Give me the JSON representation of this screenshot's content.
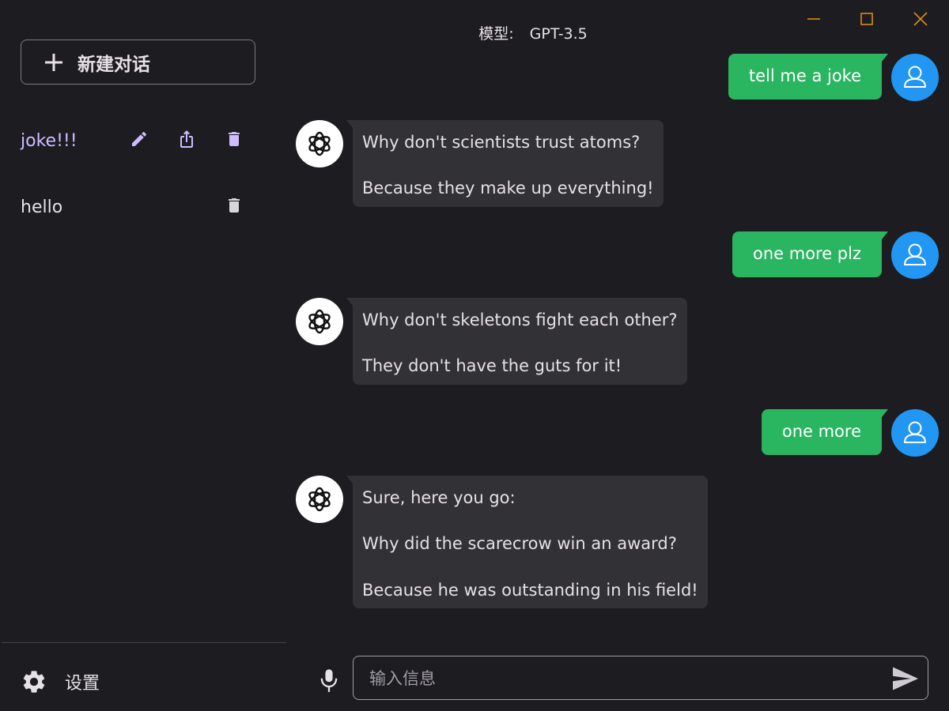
{
  "sidebar": {
    "new_chat_label": "新建对话",
    "conversations": [
      {
        "title": "joke!!!",
        "active": true
      },
      {
        "title": "hello",
        "active": false
      }
    ],
    "settings_label": "设置"
  },
  "header": {
    "model_label": "模型:",
    "model_value": "GPT-3.5"
  },
  "messages": [
    {
      "role": "user",
      "lines": [
        "tell me a joke"
      ]
    },
    {
      "role": "assistant",
      "lines": [
        "Why don't scientists trust atoms?",
        "Because they make up everything!"
      ]
    },
    {
      "role": "user",
      "lines": [
        "one more plz"
      ]
    },
    {
      "role": "assistant",
      "lines": [
        "Why don't skeletons fight each other?",
        "They don't have the guts for it!"
      ]
    },
    {
      "role": "user",
      "lines": [
        "one more"
      ]
    },
    {
      "role": "assistant",
      "lines": [
        "Sure, here you go:",
        "Why did the scarecrow win an award?",
        "Because he was outstanding in his field!"
      ]
    }
  ],
  "composer": {
    "placeholder": "输入信息"
  },
  "colors": {
    "background": "#1d1c21",
    "accent": "#cfbcff",
    "user_bubble": "#2ab560",
    "bot_bubble": "#323136",
    "user_avatar": "#2196f3"
  },
  "icons": {
    "new_chat": "plus-icon",
    "edit": "pencil-icon",
    "share": "share-icon",
    "delete": "trash-icon",
    "settings": "gear-icon",
    "mic": "microphone-icon",
    "send": "send-icon",
    "bot_avatar": "openai-logo-icon",
    "user_avatar": "user-icon"
  }
}
